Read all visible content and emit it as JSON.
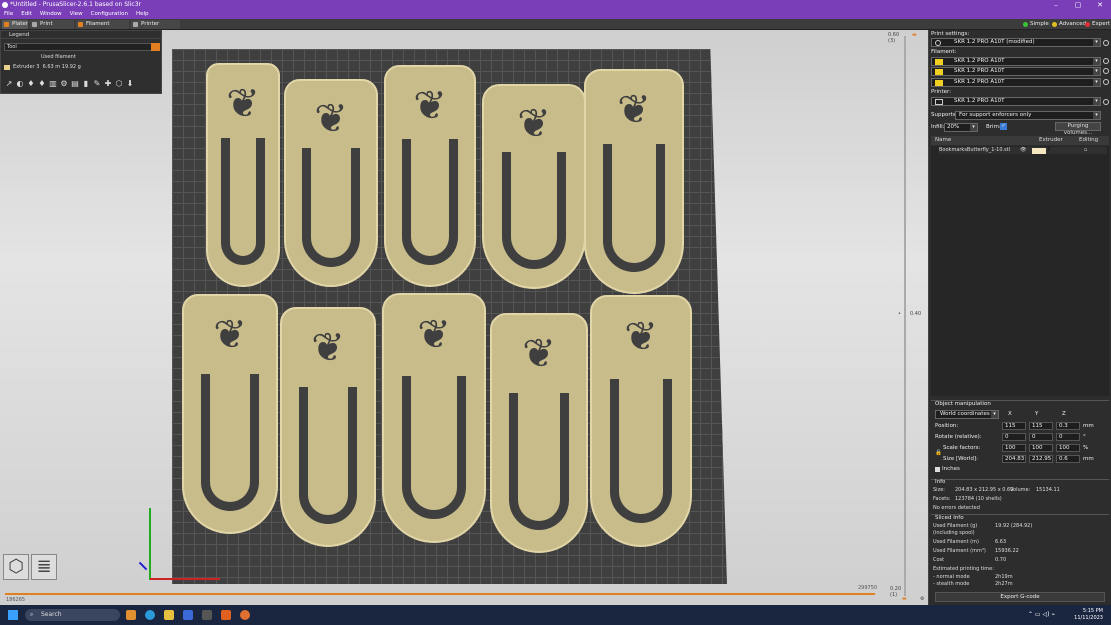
{
  "window": {
    "title": "*Untitled - PrusaSlicer-2.6.1 based on Slic3r",
    "minimize": "–",
    "maximize": "▢",
    "close": "✕"
  },
  "menu": [
    "File",
    "Edit",
    "Window",
    "View",
    "Configuration",
    "Help"
  ],
  "tabs": [
    {
      "label": "Plater",
      "color": "#e08020"
    },
    {
      "label": "Print Settings",
      "color": "#aaaaaa"
    },
    {
      "label": "Filament Settings",
      "color": "#e08020"
    },
    {
      "label": "Printer Settings",
      "color": "#aaaaaa"
    }
  ],
  "modes": [
    {
      "label": "Simple",
      "color": "#38c038"
    },
    {
      "label": "Advanced",
      "color": "#e0c020"
    },
    {
      "label": "Expert",
      "color": "#e03030"
    }
  ],
  "legend": {
    "header": "Legend",
    "view_type": "Tool",
    "used_filament": "Used filament",
    "extruder": "Extruder 3",
    "extruder_usage": "6.63 m   19.92 g"
  },
  "vslider": {
    "top_value": "0.60",
    "top_layer": "(3)",
    "mid_value": "0.40",
    "bottom_value": "0.20",
    "bottom_layer": "(1)"
  },
  "hslider": {
    "left": "186265",
    "right": "299750"
  },
  "right": {
    "print_settings_label": "Print settings:",
    "print_profile": "SKR 1.2 PRO A10T (modified)",
    "filament_label": "Filament:",
    "filaments": [
      "SKR 1.2 PRO A10T",
      "SKR 1.2 PRO A10T",
      "SKR 1.2 PRO A10T"
    ],
    "filament_color": "#f0d020",
    "printer_label": "Printer:",
    "printer_profile": "SKR 1.2 PRO A10T",
    "supports_label": "Supports:",
    "supports_value": "For support enforcers only",
    "infill_label": "Infill:",
    "infill_value": "20%",
    "brim_label": "Brim:",
    "brim_value": "✓",
    "purging_button": "Purging volumes...",
    "object_list": {
      "col_name": "Name",
      "col_extruder": "Extruder",
      "col_editing": "Editing",
      "object_name": "BookmarksButterfly_1-10.stl",
      "object_extruder": "3",
      "object_extruder_color": "#f5e8c0"
    },
    "manip": {
      "title": "Object manipulation",
      "coord_system": "World coordinates",
      "x": "X",
      "y": "Y",
      "z": "Z",
      "position_label": "Position:",
      "position": [
        "115",
        "115",
        "0.3"
      ],
      "position_unit": "mm",
      "rotate_label": "Rotate (relative):",
      "rotate": [
        "0",
        "0",
        "0"
      ],
      "rotate_unit": "°",
      "scale_label": "Scale factors:",
      "scale": [
        "100",
        "100",
        "100"
      ],
      "scale_unit": "%",
      "size_label": "Size [World]:",
      "size": [
        "204.83",
        "212.95",
        "0.6"
      ],
      "size_unit": "mm",
      "inches": "Inches"
    },
    "info": {
      "title": "Info",
      "size_label": "Size:",
      "size_value": "204.83 x 212.95 x 0.60",
      "volume_label": "Volume:",
      "volume_value": "15134.11",
      "facets_label": "Facets:",
      "facets_value": "123784 (10 shells)",
      "errors": "No errors detected"
    },
    "sliced": {
      "title": "Sliced Info",
      "rows": [
        {
          "label": "Used Filament (g)",
          "value": "19.92 (284.92)"
        },
        {
          "label": "(including spool)",
          "value": ""
        },
        {
          "label": "Used Filament (m)",
          "value": "6.63"
        },
        {
          "label": "Used Filament (mm³)",
          "value": "15936.22"
        },
        {
          "label": "Cost",
          "value": "0.70"
        },
        {
          "label": "Estimated printing time:",
          "value": ""
        },
        {
          "label": " - normal mode",
          "value": "2h19m"
        },
        {
          "label": " - stealth mode",
          "value": "2h27m"
        }
      ]
    },
    "export_button": "Export G-code"
  },
  "taskbar": {
    "search": "Search",
    "time": "5:15 PM",
    "date": "11/11/2023"
  }
}
